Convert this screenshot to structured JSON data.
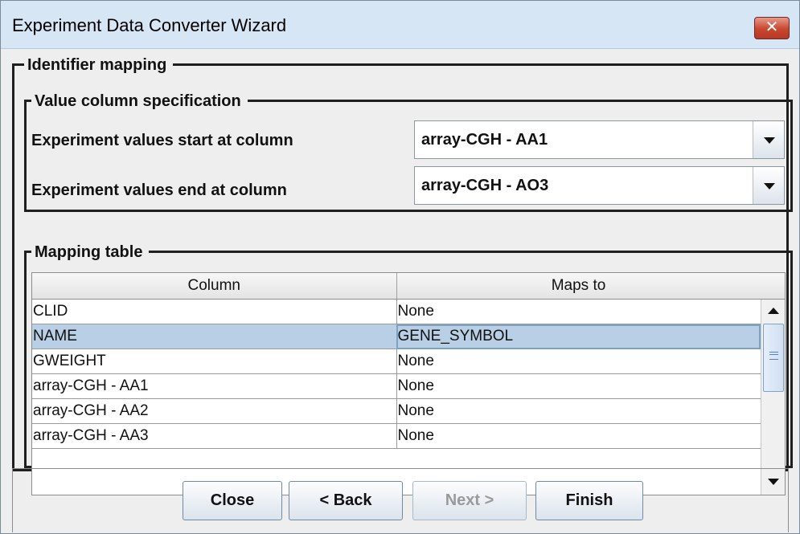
{
  "window": {
    "title": "Experiment Data Converter Wizard"
  },
  "identifier_mapping": {
    "label": "Identifier mapping",
    "value_column_spec": {
      "label": "Value column specification",
      "start": {
        "label": "Experiment values start at column",
        "value": "array-CGH - AA1"
      },
      "end": {
        "label": "Experiment values  end  at column",
        "value": "array-CGH - AO3"
      }
    },
    "mapping_table": {
      "label": "Mapping table",
      "headers": [
        "Column",
        "Maps to"
      ],
      "rows": [
        [
          "CLID",
          "None"
        ],
        [
          "NAME",
          "GENE_SYMBOL"
        ],
        [
          "GWEIGHT",
          "None"
        ],
        [
          "array-CGH - AA1",
          "None"
        ],
        [
          "array-CGH - AA2",
          "None"
        ],
        [
          "array-CGH - AA3",
          "None"
        ]
      ],
      "selected_row": 1
    }
  },
  "buttons": {
    "close": "Close",
    "back": "< Back",
    "next": "Next >",
    "finish": "Finish"
  }
}
